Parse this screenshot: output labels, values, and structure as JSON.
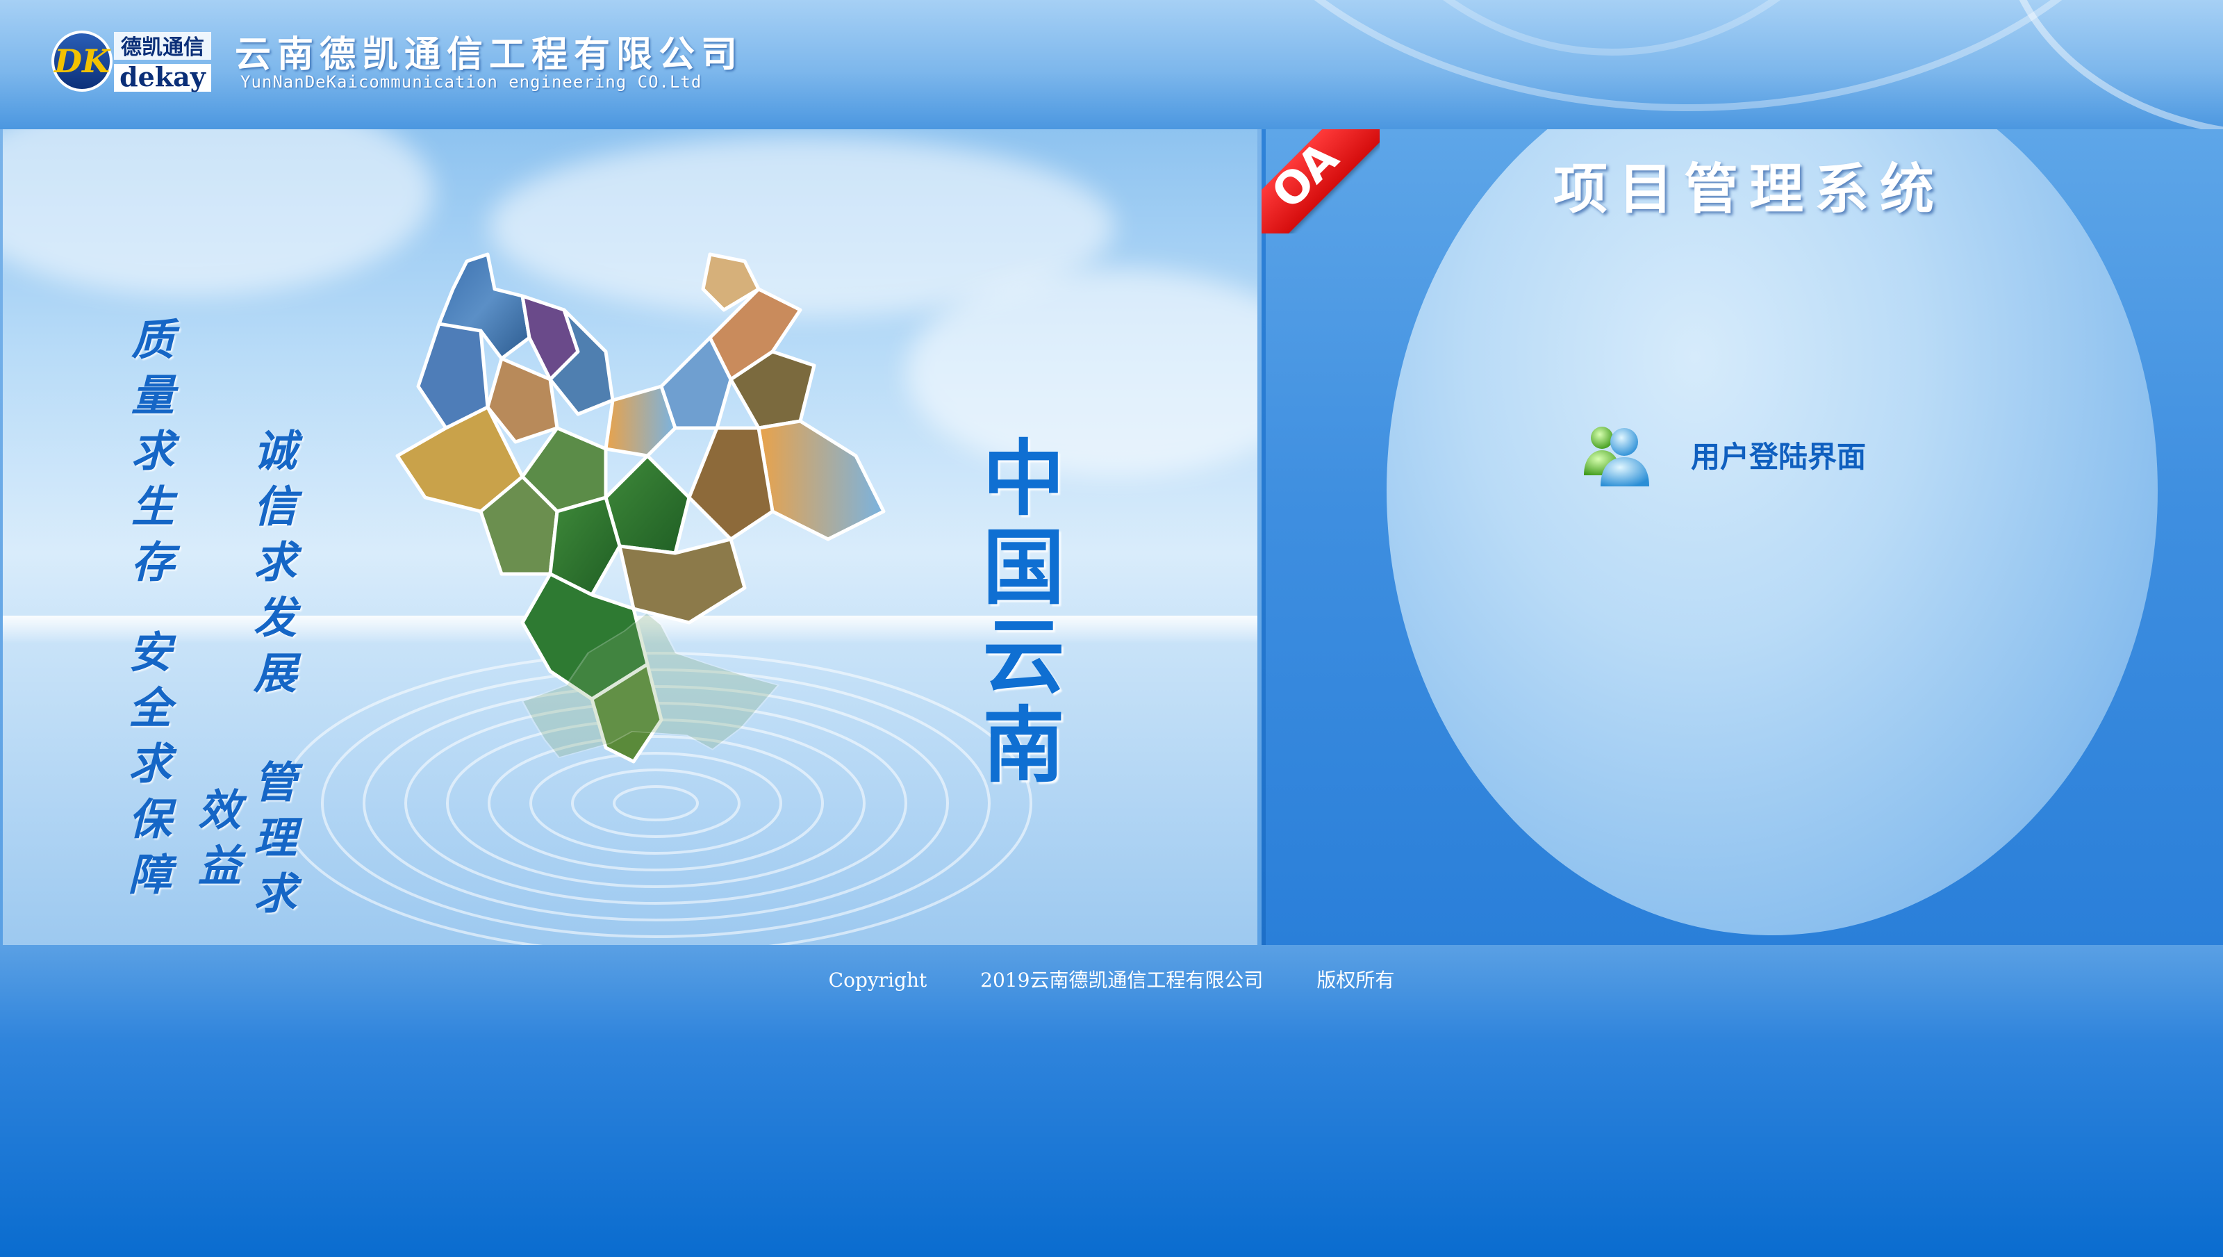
{
  "header": {
    "logo_cn": "德凯通信",
    "logo_en": "dekay",
    "logo_mark": "DK",
    "company_name_cn": "云南德凯通信工程有限公司",
    "company_name_en": "YunNanDeKaicommunication engineering CO.Ltd"
  },
  "banner": {
    "slogans": [
      "质量求生存",
      "安全求保障",
      "诚信求发展",
      "管理求效益"
    ],
    "region_title": "中国云南",
    "map_icon": "yunnan-map-collage"
  },
  "panel": {
    "ribbon": "OA",
    "system_title": "项目管理系统",
    "login": {
      "icon": "users-icon",
      "label": "用户登陆界面"
    }
  },
  "footer": {
    "copyright": "Copyright",
    "owner": "2019云南德凯通信工程有限公司",
    "rights": "版权所有"
  },
  "colors": {
    "accent": "#0f6fd2",
    "ribbon_red": "#e01515",
    "header_blue": "#7db7ec",
    "footer_blue": "#0a6ccf"
  }
}
